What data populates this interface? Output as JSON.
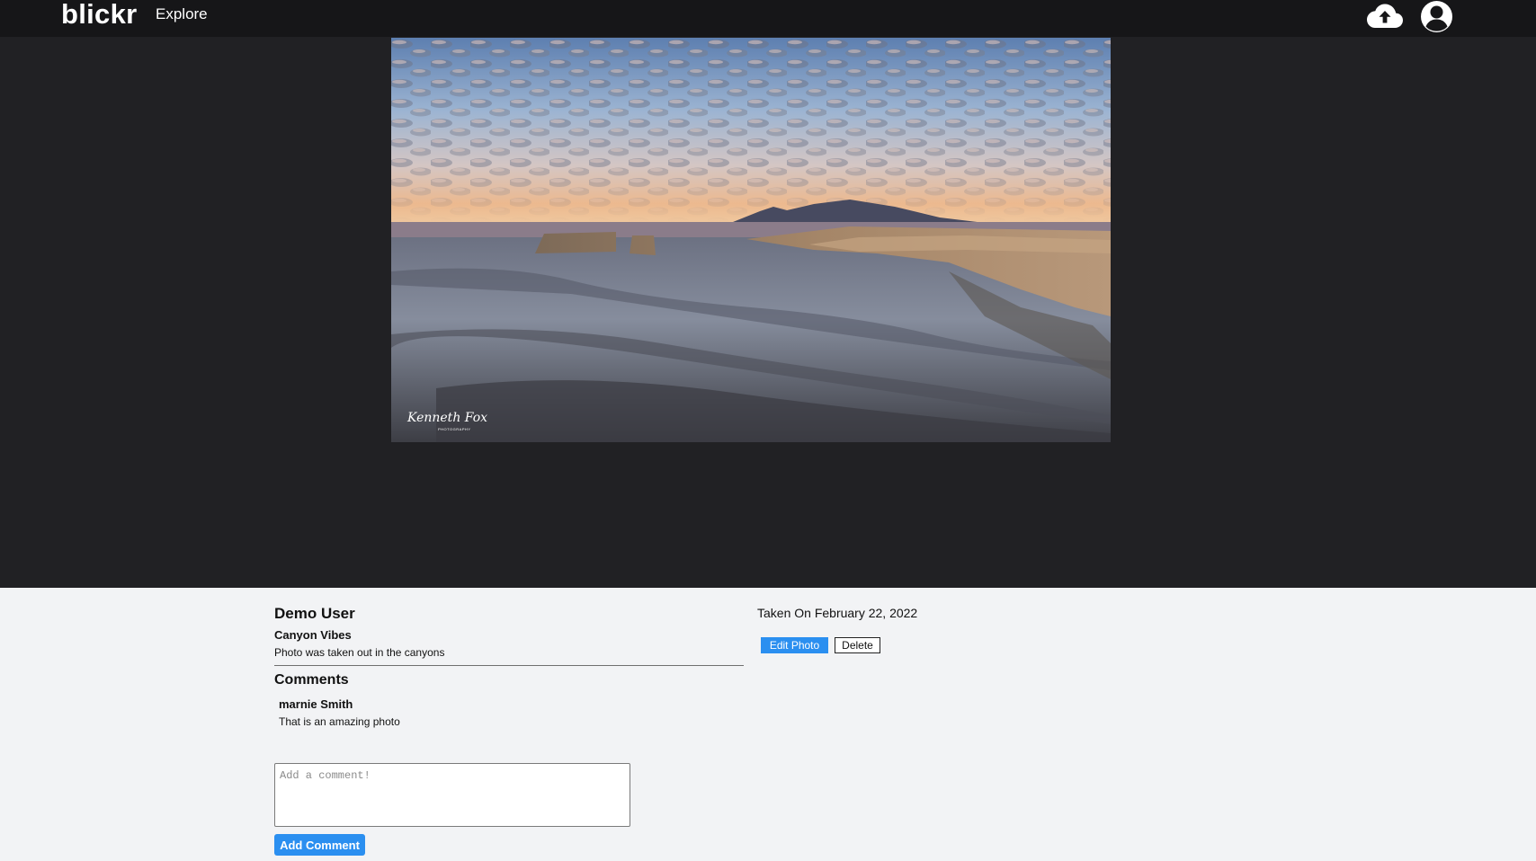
{
  "header": {
    "logo": "blickr",
    "nav_explore": "Explore",
    "upload_icon": "cloud-upload-icon",
    "account_icon": "user-circle-icon"
  },
  "photo": {
    "watermark_name": "Kenneth Fox",
    "watermark_sub": "PHOTOGRAPHY"
  },
  "details": {
    "owner": "Demo User",
    "title": "Canyon Vibes",
    "description": "Photo was taken out in the canyons",
    "taken_on": "Taken On February 22, 2022",
    "edit_label": "Edit Photo",
    "delete_label": "Delete"
  },
  "comments": {
    "heading": "Comments",
    "items": [
      {
        "author": "marnie Smith",
        "text": "That is an amazing photo"
      }
    ],
    "input_placeholder": "Add a comment!",
    "input_value": "",
    "submit_label": "Add Comment"
  },
  "colors": {
    "header_bg": "#161618",
    "stage_bg": "#212124",
    "page_bg": "#f2f3f5",
    "accent": "#2b8ff0"
  }
}
